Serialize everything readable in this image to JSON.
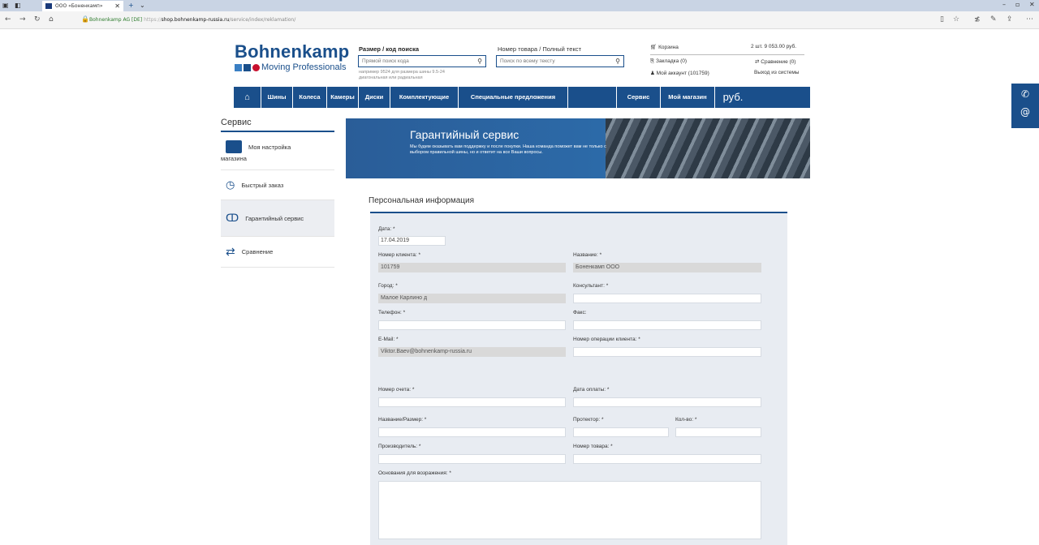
{
  "browser": {
    "tab_title": "ООО «Боненкамп»",
    "site_label": "Bohnenkamp AG [DE]",
    "url_scheme": "https://",
    "url_host": "shop.bohnenkamp-russia.ru",
    "url_path": "/service/index/reklamation/"
  },
  "header": {
    "logo_word": "Bohnenkamp",
    "logo_sub": "Moving Professionals",
    "logo_colors": [
      "#3a7fc4",
      "#1a4f8b",
      "#c8102e"
    ],
    "size_label": "Размер / код поиска",
    "size_placeholder": "Прямой поиск кода",
    "size_hint1": "например 9524 для размера шины 9.5-24",
    "size_hint2": "диагональная или радиальная",
    "part_label": "Номер товара / Полный текст",
    "part_placeholder": "Поиск по всему тексту",
    "cart_label": "Корзина",
    "cart_summary": "2 шт.  9 053.00 руб.",
    "bookmark_label": "Закладка (0)",
    "compare_label": "Сравнение (0)",
    "account_label": "Мой аккаунт (101759)",
    "logout_label": "Выход из системы"
  },
  "nav": [
    "Шины",
    "Колеса",
    "Камеры",
    "Диски",
    "Комплектующие",
    "Специальные предложения",
    "Сервис",
    "Мой магазин",
    "руб."
  ],
  "sidebar": {
    "title": "Сервис",
    "items": [
      {
        "label": "Моя настройка",
        "label2": "магазина"
      },
      {
        "label": "Быстрый заказ"
      },
      {
        "label": "Гарантийный сервис"
      },
      {
        "label": "Сравнение"
      }
    ]
  },
  "banner": {
    "title": "Гарантийный сервис",
    "text": "Мы будем оказывать вам поддержку и после покупки. Наша команда поможет вам не только с выбором правильной шины, но и ответит на все Ваши вопросы."
  },
  "form": {
    "section_title": "Персональная информация",
    "date_label": "Дата: *",
    "date_value": "17.04.2019",
    "client_no_label": "Номер клиента: *",
    "client_no_value": "101759",
    "name_label": "Название: *",
    "name_value": "Боненкамп ООО",
    "city_label": "Город: *",
    "city_value": "Малое Карлино д",
    "consultant_label": "Консультант: *",
    "phone_label": "Телефон: *",
    "fax_label": "Факс:",
    "email_label": "E-Mail: *",
    "email_value": "Viktor.Baev@bohnenkamp-russia.ru",
    "op_no_label": "Номер операции клиента: *",
    "invoice_label": "Номер счета: *",
    "pay_date_label": "Дата оплаты: *",
    "item_name_label": "Название/Размер: *",
    "tread_label": "Протектор: *",
    "qty_label": "Кол-во: *",
    "manufacturer_label": "Производитель: *",
    "item_no_label": "Номер товара: *",
    "reason_label": "Основания для возражения: *"
  },
  "contact": {
    "phone_icon": "phone-icon",
    "mail_icon": "at-icon"
  }
}
